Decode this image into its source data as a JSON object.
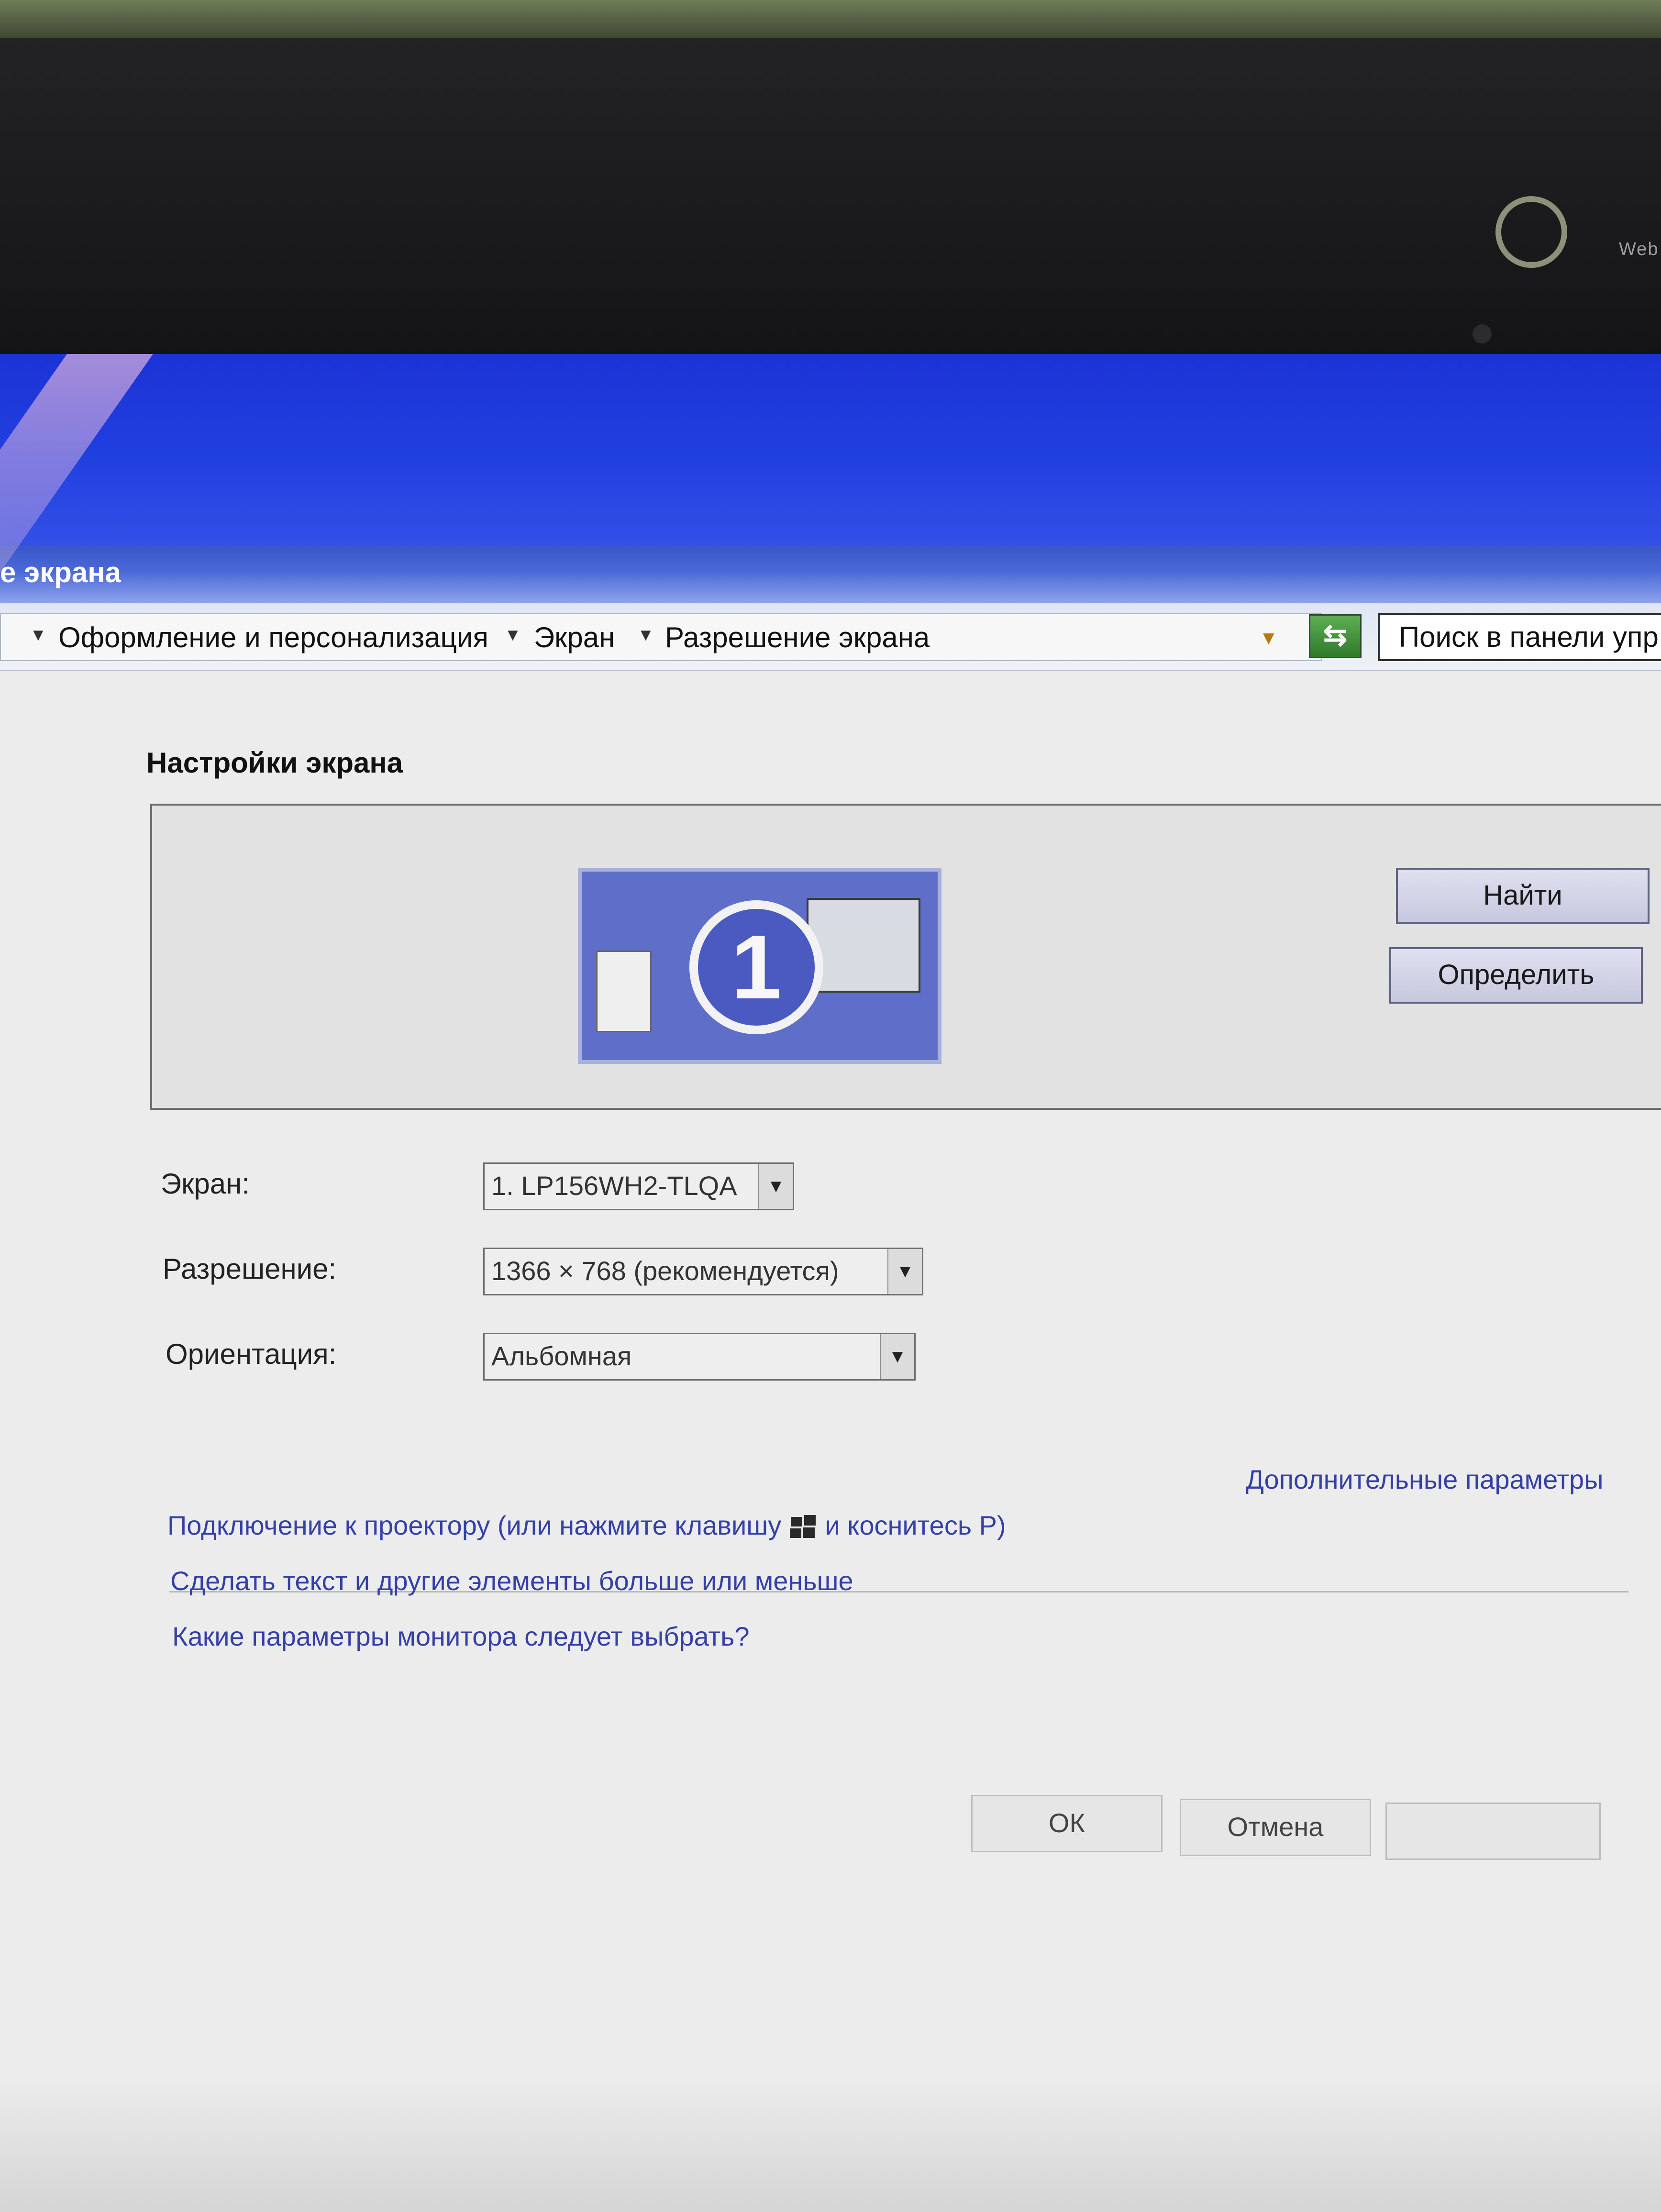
{
  "bezel": {
    "label": "Web"
  },
  "window": {
    "title": "е экрана"
  },
  "breadcrumb": {
    "items": [
      "Оформление и персонализация",
      "Экран",
      "Разрешение экрана"
    ]
  },
  "search": {
    "placeholder": "Поиск в панели упр"
  },
  "main": {
    "heading": "Настройки экрана",
    "monitor_number": "1",
    "find_button": "Найти",
    "identify_button": "Определить",
    "fields": {
      "display_label": "Экран:",
      "display_value": "1. LP156WH2-TLQA",
      "resolution_label": "Разрешение:",
      "resolution_value": "1366 × 768 (рекомендуется)",
      "orientation_label": "Ориентация:",
      "orientation_value": "Альбомная"
    },
    "advanced_link": "Дополнительные параметры",
    "links": {
      "projector_before": "Подключение к проектору (или нажмите клавишу",
      "projector_after": "и коснитесь P)",
      "text_size": "Сделать текст и другие элементы больше или меньше",
      "which_settings": "Какие параметры монитора следует выбрать?"
    }
  },
  "footer": {
    "ok": "ОК",
    "cancel": "Отмена",
    "apply": ""
  }
}
